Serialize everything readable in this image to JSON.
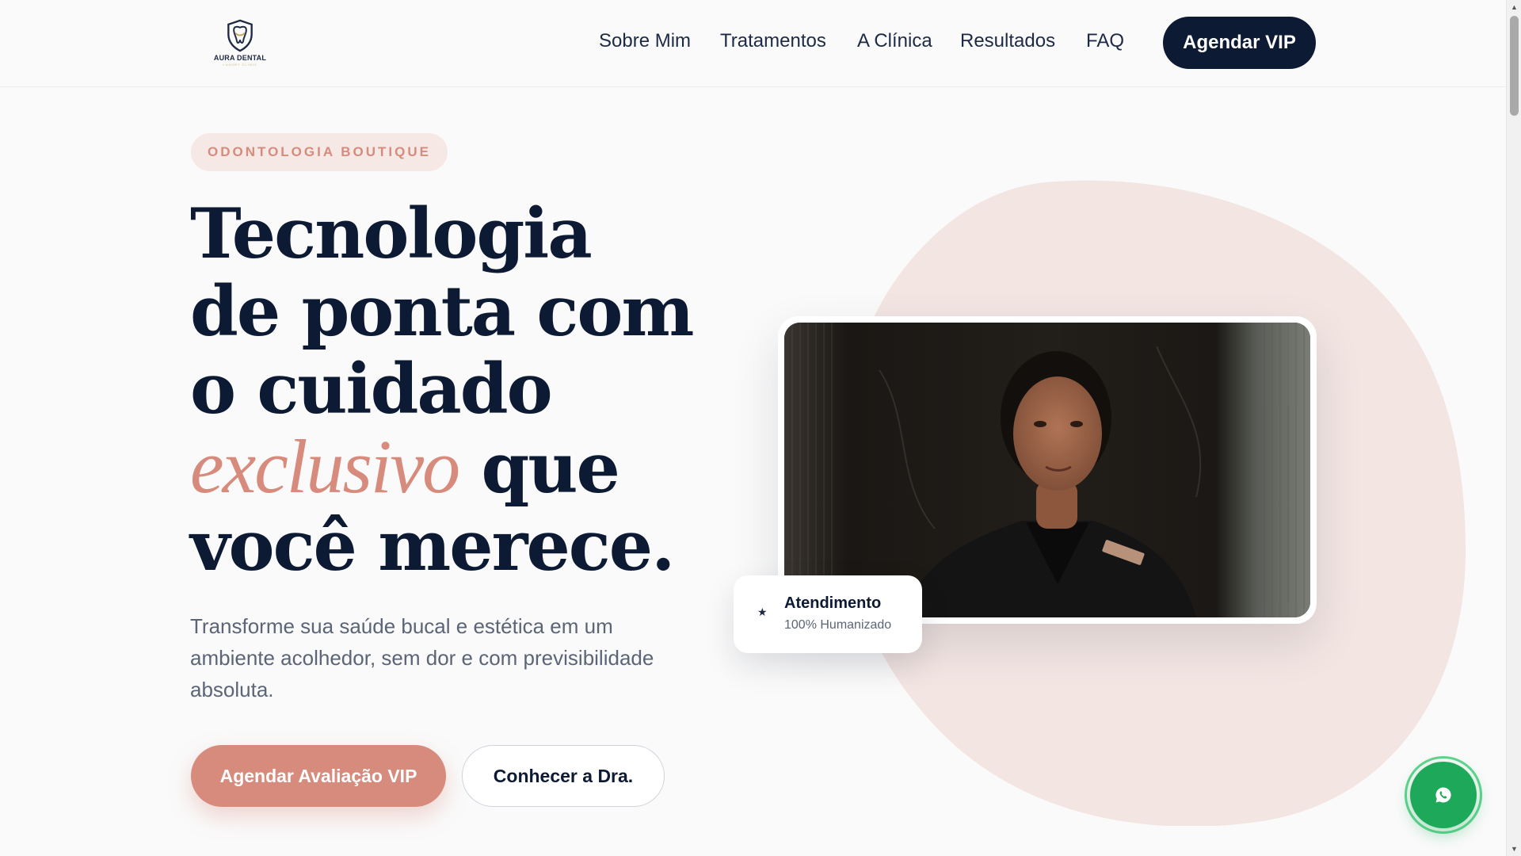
{
  "brand": {
    "name": "AURA DENTAL",
    "tagline": "LUXURY CLINIC"
  },
  "nav": {
    "links": [
      "Sobre Mim",
      "Tratamentos",
      "A Clínica",
      "Resultados",
      "FAQ"
    ],
    "cta": "Agendar VIP"
  },
  "hero": {
    "badge": "ODONTOLOGIA BOUTIQUE",
    "headline": {
      "line1": "Tecnologia",
      "line2": "de ponta com",
      "line3": "o cuidado",
      "accent": "exclusivo",
      "line4_rest": "que",
      "line5": "você merece."
    },
    "subtitle": "Transforme sua saúde bucal e estética em um ambiente acolhedor, sem dor e com previsibilidade absoluta.",
    "primary_button": "Agendar Avaliação VIP",
    "secondary_button": "Conhecer a Dra."
  },
  "stat_card": {
    "icon": "star-icon",
    "title": "Atendimento",
    "subtitle": "100% Humanizado"
  },
  "floating": {
    "whatsapp_icon": "whatsapp-icon"
  },
  "colors": {
    "navy": "#0c1a33",
    "rose": "#d68b7d",
    "blush": "#f6e8e5",
    "whatsapp_green": "#1ea85a"
  }
}
